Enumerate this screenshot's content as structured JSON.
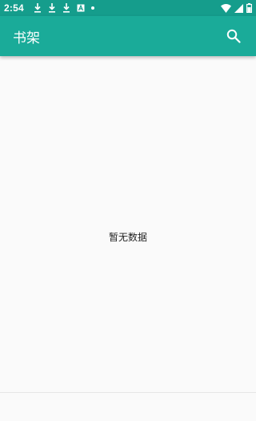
{
  "status_bar": {
    "time": "2:54",
    "left_icons": [
      "download-icon",
      "download-icon",
      "download-icon",
      "a-box-icon",
      "dot-icon"
    ],
    "right_icons": [
      "wifi-icon",
      "signal-icon",
      "battery-icon"
    ]
  },
  "app_bar": {
    "title": "书架",
    "action_icon": "search-icon",
    "color": "#1aab99"
  },
  "content": {
    "empty_text": "暂无数据"
  }
}
